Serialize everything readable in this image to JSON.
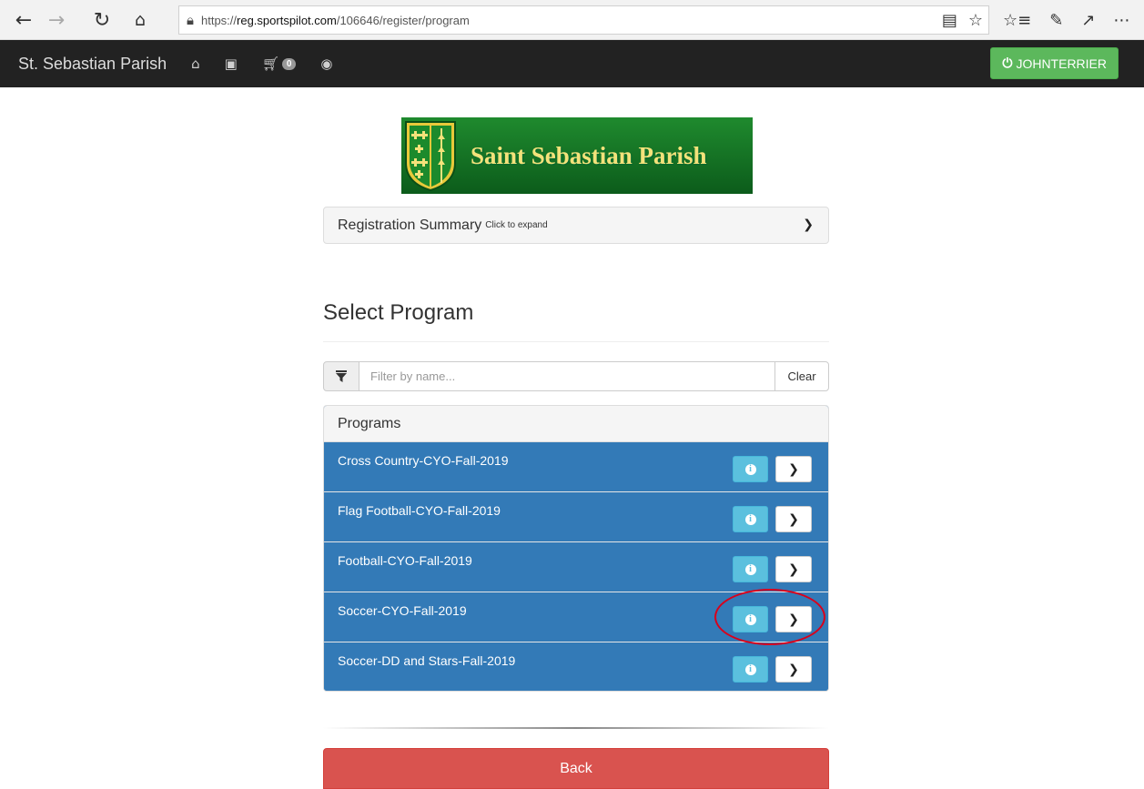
{
  "browser": {
    "url_prefix": "https://",
    "url_host": "reg.sportspilot.com",
    "url_path": "/106646/register/program",
    "icons": [
      "back-arrow-icon",
      "forward-arrow-icon",
      "refresh-icon",
      "home-icon",
      "lock-icon",
      "reading-view-icon",
      "favorite-star-icon",
      "favorites-list-icon",
      "pen-icon",
      "share-icon",
      "more-icon"
    ]
  },
  "navbar": {
    "brand": "St. Sebastian Parish",
    "cart_count": "0",
    "user_label": "JOHNTERRIER",
    "icons": [
      "home-icon",
      "archive-icon",
      "cart-icon",
      "help-icon",
      "power-icon"
    ],
    "colors": {
      "background": "#222222",
      "user_button": "#5cb85c"
    }
  },
  "logo": {
    "text": "Saint Sebastian Parish"
  },
  "summary": {
    "title": "Registration Summary",
    "hint": "Click to expand"
  },
  "section": {
    "title": "Select Program"
  },
  "filter": {
    "placeholder": "Filter by name...",
    "clear_label": "Clear"
  },
  "programs": {
    "heading": "Programs",
    "items": [
      {
        "label": "Cross Country-CYO-Fall-2019"
      },
      {
        "label": "Flag Football-CYO-Fall-2019"
      },
      {
        "label": "Football-CYO-Fall-2019"
      },
      {
        "label": "Soccer-CYO-Fall-2019"
      },
      {
        "label": "Soccer-DD and Stars-Fall-2019"
      }
    ],
    "colors": {
      "row": "#337ab7",
      "info_button": "#5bc0de"
    }
  },
  "back": {
    "label": "Back",
    "color": "#d9534f"
  }
}
